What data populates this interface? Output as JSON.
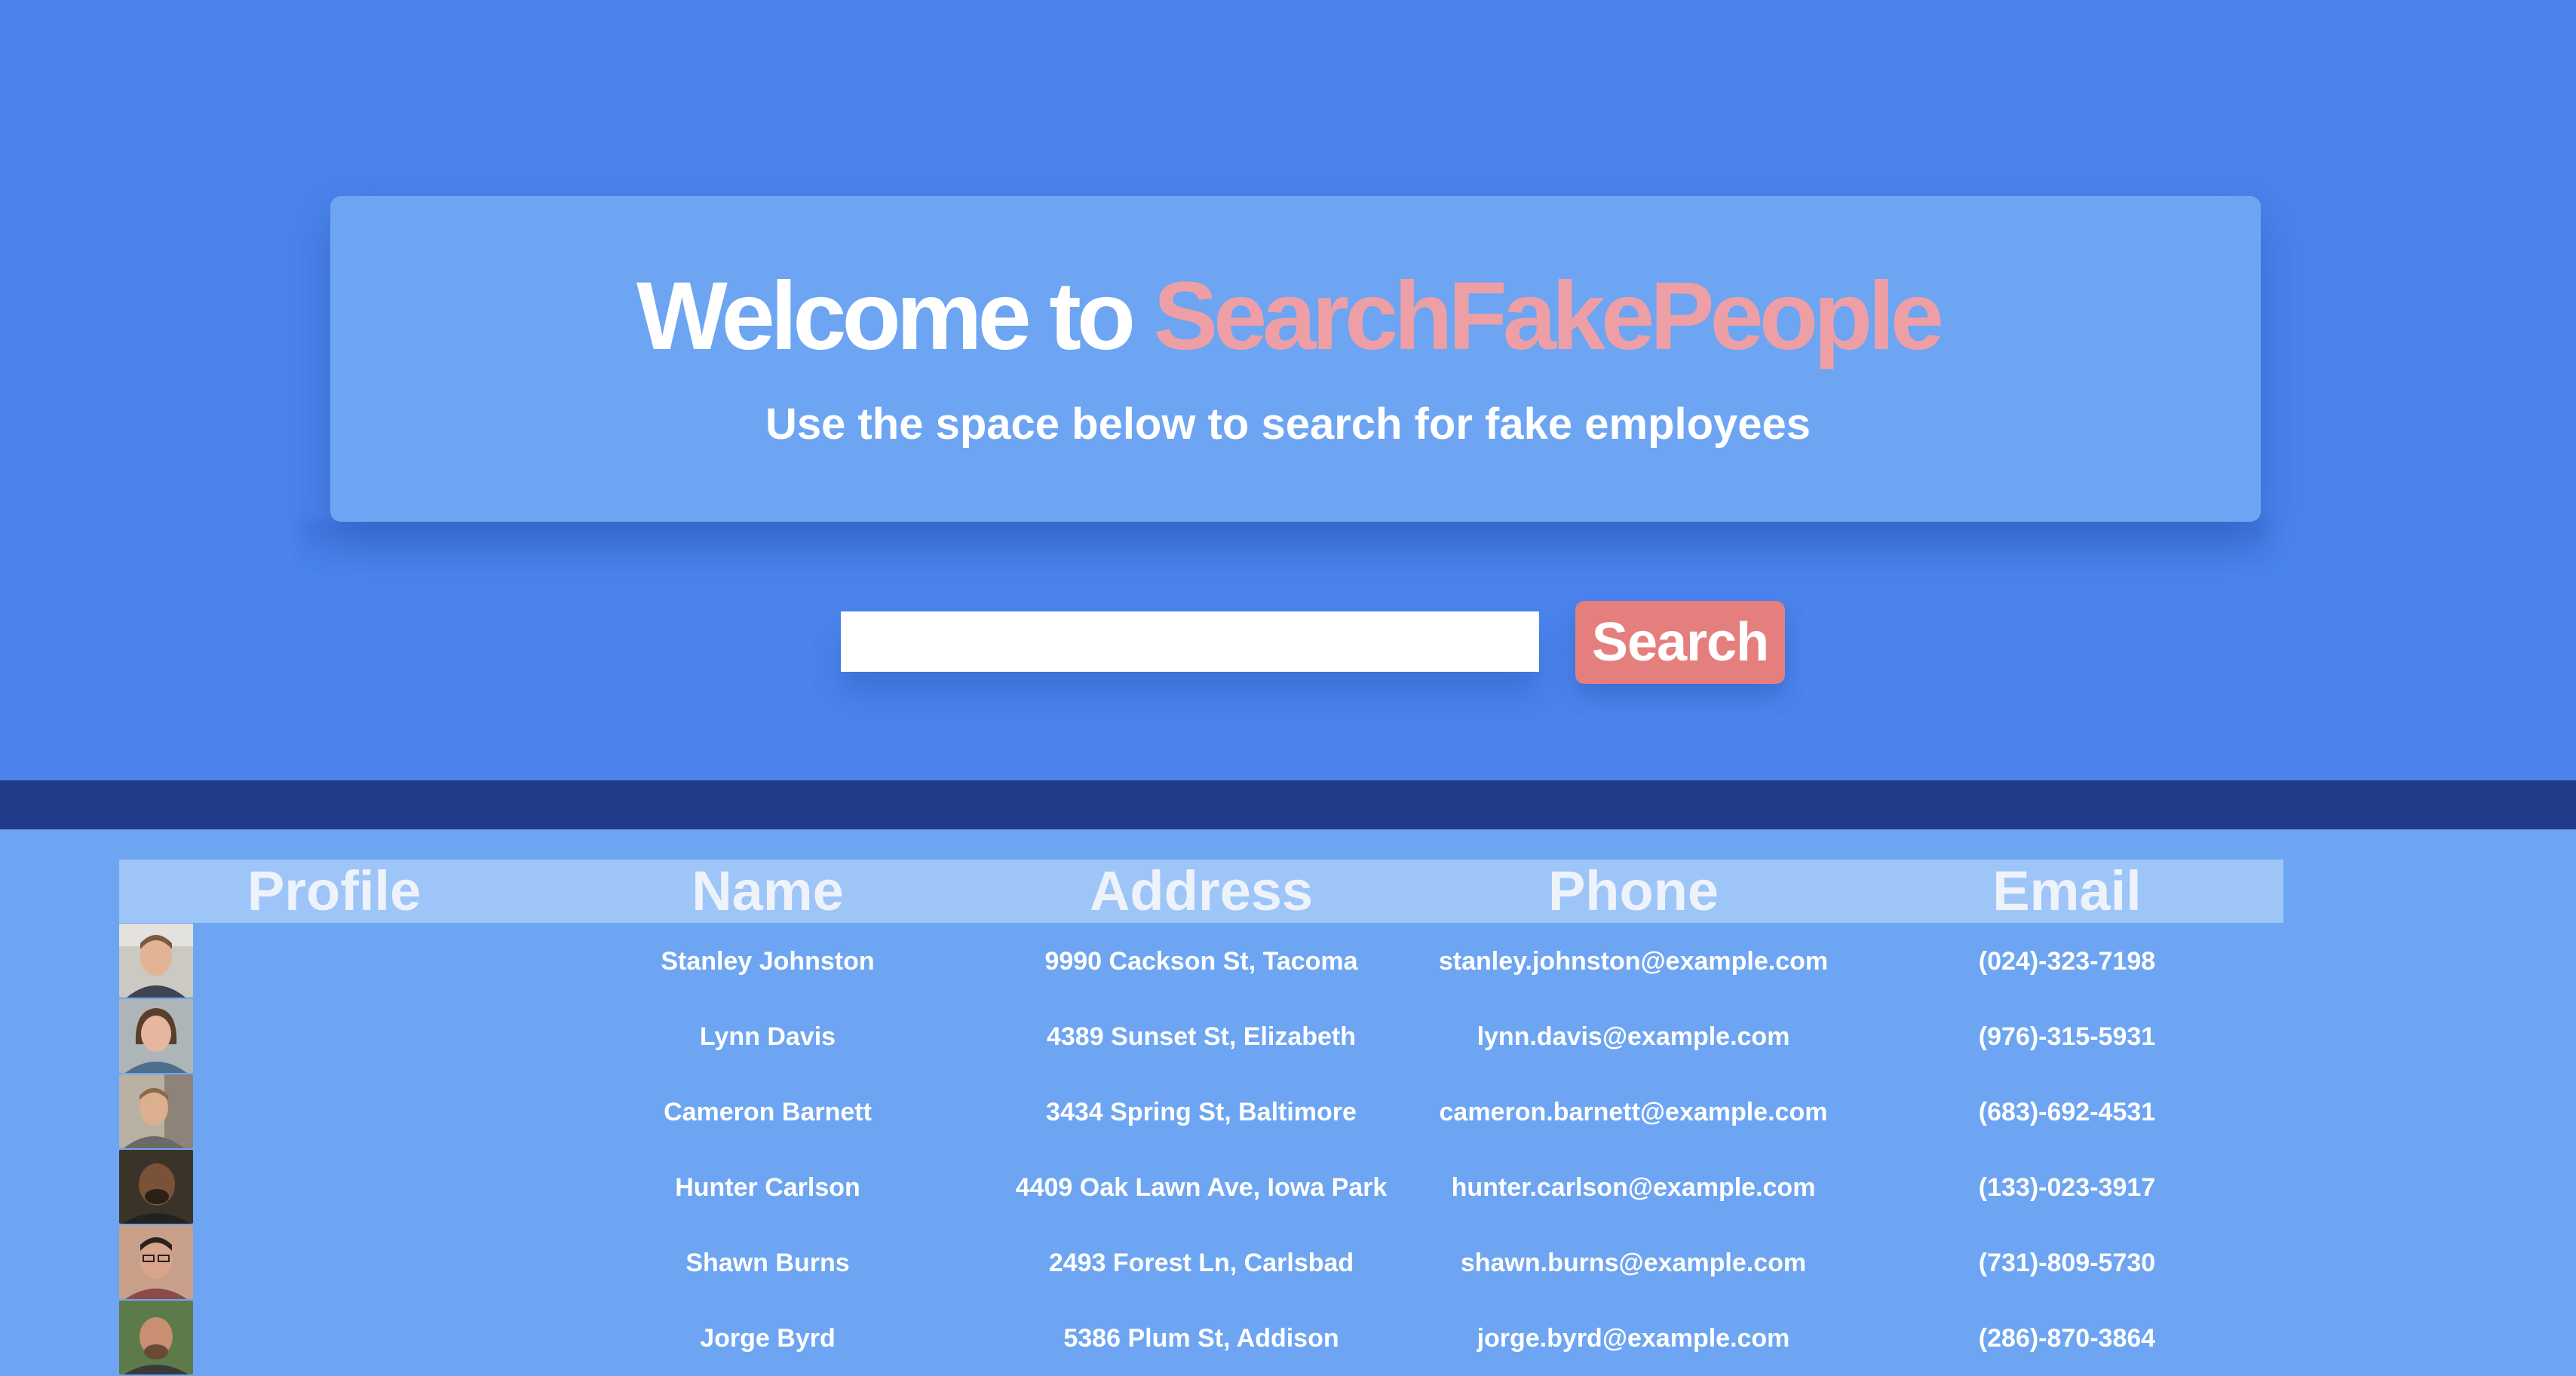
{
  "hero": {
    "title_prefix": "Welcome to ",
    "title_brand": "SearchFakePeople",
    "subtitle": "Use the space below to search for fake employees"
  },
  "search": {
    "value": "",
    "placeholder": "",
    "button_label": "Search"
  },
  "table": {
    "columns": [
      "Profile",
      "Name",
      "Address",
      "Phone",
      "Email"
    ],
    "rows": [
      {
        "name": "Stanley Johnston",
        "address": "9990 Cackson St, Tacoma",
        "phone": "stanley.johnston@example.com",
        "email": "(024)-323-7198"
      },
      {
        "name": "Lynn Davis",
        "address": "4389 Sunset St, Elizabeth",
        "phone": "lynn.davis@example.com",
        "email": "(976)-315-5931"
      },
      {
        "name": "Cameron Barnett",
        "address": "3434 Spring St, Baltimore",
        "phone": "cameron.barnett@example.com",
        "email": "(683)-692-4531"
      },
      {
        "name": "Hunter Carlson",
        "address": "4409 Oak Lawn Ave, Iowa Park",
        "phone": "hunter.carlson@example.com",
        "email": "(133)-023-3917"
      },
      {
        "name": "Shawn Burns",
        "address": "2493 Forest Ln, Carlsbad",
        "phone": "shawn.burns@example.com",
        "email": "(731)-809-5730"
      },
      {
        "name": "Jorge Byrd",
        "address": "5386 Plum St, Addison",
        "phone": "jorge.byrd@example.com",
        "email": "(286)-870-3864"
      }
    ]
  },
  "colors": {
    "hero_bg": "#4a84ec",
    "card_bg": "#6da5f2",
    "brand_pink": "#ee9fa6",
    "button_bg": "#e57f7e",
    "band": "#223b88",
    "header_bg": "#9ec5f7"
  }
}
